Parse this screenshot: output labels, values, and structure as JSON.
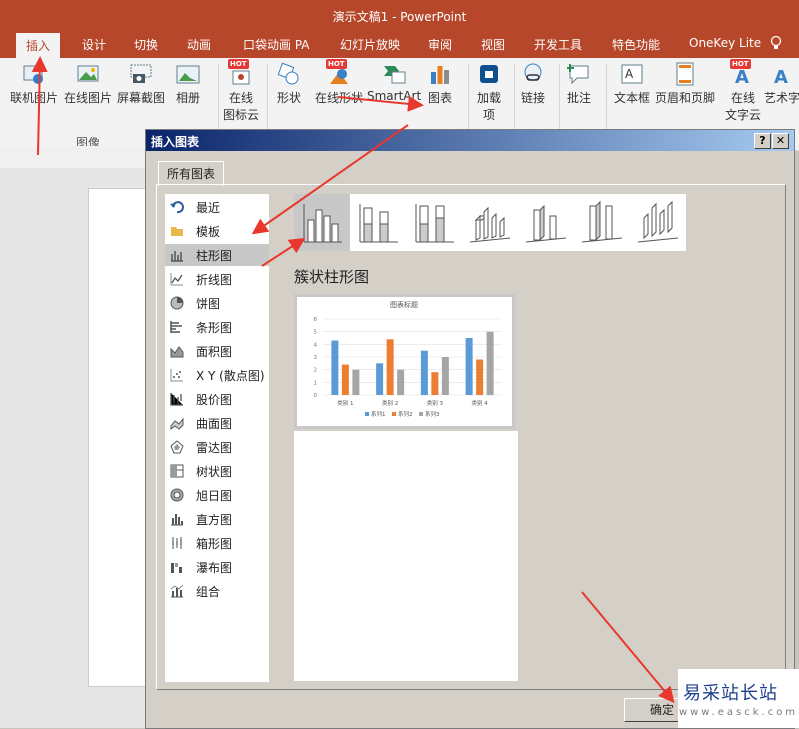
{
  "app": {
    "title": "演示文稿1 - PowerPoint"
  },
  "tabs": [
    "插入",
    "设计",
    "切换",
    "动画",
    "口袋动画 PA",
    "幻灯片放映",
    "审阅",
    "视图",
    "开发工具",
    "特色功能",
    "OneKey Lite"
  ],
  "ribbon": {
    "buttons": [
      "联机图片",
      "在线图片",
      "屏幕截图",
      "相册",
      "在线",
      "图标云",
      "形状",
      "在线形状",
      "SmartArt",
      "图表",
      "加载",
      "项",
      "链接",
      "批注",
      "文本框",
      "页眉和页脚",
      "在线",
      "文字云",
      "艺术字"
    ],
    "hot_badge": "HOT",
    "group_images": "图像"
  },
  "dialog": {
    "title": "插入图表",
    "help": "?",
    "close": "✕",
    "tab": "所有图表",
    "categories": [
      "最近",
      "模板",
      "柱形图",
      "折线图",
      "饼图",
      "条形图",
      "面积图",
      "X Y (散点图)",
      "股价图",
      "曲面图",
      "雷达图",
      "树状图",
      "旭日图",
      "直方图",
      "箱形图",
      "瀑布图",
      "组合"
    ],
    "selected_type": "簇状柱形图",
    "ok_button": "确定"
  },
  "chart_data": {
    "type": "bar",
    "title": "图表标题",
    "categories": [
      "类别 1",
      "类别 2",
      "类别 3",
      "类别 4"
    ],
    "series": [
      {
        "name": "系列1",
        "values": [
          4.3,
          2.5,
          3.5,
          4.5
        ]
      },
      {
        "name": "系列2",
        "values": [
          2.4,
          4.4,
          1.8,
          2.8
        ]
      },
      {
        "name": "系列3",
        "values": [
          2.0,
          2.0,
          3.0,
          5.0
        ]
      }
    ],
    "ylim": [
      0,
      6
    ],
    "yticks": [
      "0",
      "1",
      "2",
      "3",
      "4",
      "5",
      "6"
    ],
    "colors": [
      "#5b9bd5",
      "#ed7d31",
      "#a5a5a5"
    ],
    "legend": "bottom",
    "grid": true
  },
  "watermark": {
    "line1": "易采站长站",
    "line2": "www.easck.com"
  },
  "colors": {
    "accent": "#b7472a",
    "arrow": "#e8372c"
  }
}
